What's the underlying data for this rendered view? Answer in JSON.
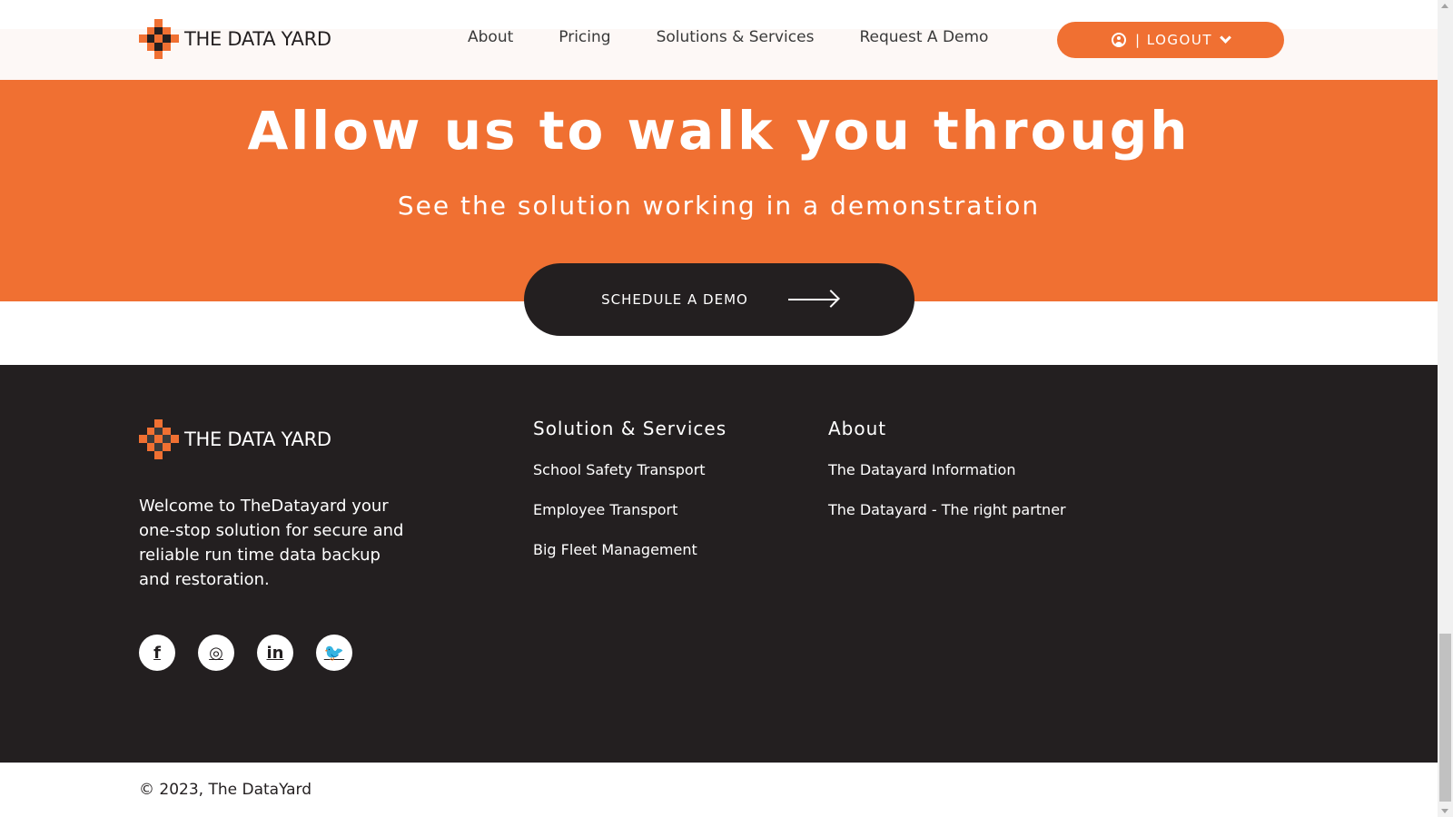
{
  "colors": {
    "accent": "#f07032",
    "dark": "#231f20",
    "white": "#ffffff"
  },
  "header": {
    "logo_text": "THE DATA YARD",
    "nav": [
      {
        "label": "About"
      },
      {
        "label": "Pricing"
      },
      {
        "label": "Solutions & Services"
      },
      {
        "label": "Request A Demo"
      }
    ],
    "logout_label": "| LOGOUT",
    "user_icon": "user-circle-icon",
    "dropdown_icon": "chevron-down-icon"
  },
  "hero": {
    "title": "Allow us to walk you through",
    "subtitle": "See the solution working in a demonstration",
    "cta_label": "SCHEDULE A DEMO",
    "cta_icon": "arrow-right-icon"
  },
  "footer": {
    "logo_text": "THE DATA YARD",
    "description": "Welcome to TheDatayard your one-stop solution for secure and reliable run time data backup and restoration.",
    "social": [
      {
        "icon": "facebook-icon",
        "glyph": "f"
      },
      {
        "icon": "instagram-icon",
        "glyph": "◎"
      },
      {
        "icon": "linkedin-icon",
        "glyph": "in"
      },
      {
        "icon": "twitter-icon",
        "glyph": "🐦"
      }
    ],
    "columns": [
      {
        "heading": "Solution & Services",
        "links": [
          "School Safety Transport",
          "Employee Transport",
          "Big Fleet Management"
        ]
      },
      {
        "heading": "About",
        "links": [
          "The Datayard Information",
          "The Datayard - The right partner"
        ]
      }
    ],
    "copyright": "© 2023, The DataYard"
  }
}
